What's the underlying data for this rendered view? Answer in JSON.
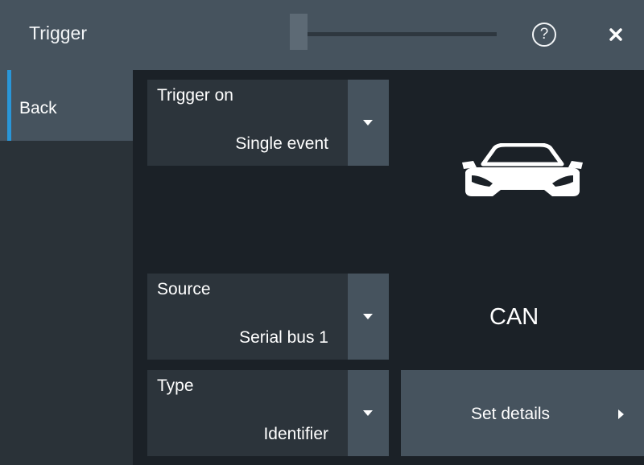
{
  "title": "Trigger",
  "header": {
    "help_icon": "question-circle-icon",
    "close_icon": "close-icon"
  },
  "sidebar": {
    "back_label": "Back"
  },
  "fields": {
    "trigger_on": {
      "label": "Trigger on",
      "value": "Single event"
    },
    "source": {
      "label": "Source",
      "value": "Serial bus 1"
    },
    "type": {
      "label": "Type",
      "value": "Identifier"
    }
  },
  "protocol": {
    "name": "CAN",
    "icon": "car-icon"
  },
  "details_button": {
    "label": "Set details"
  },
  "colors": {
    "accent": "#2996d8",
    "panel": "#46535e",
    "background": "#1b2127"
  }
}
